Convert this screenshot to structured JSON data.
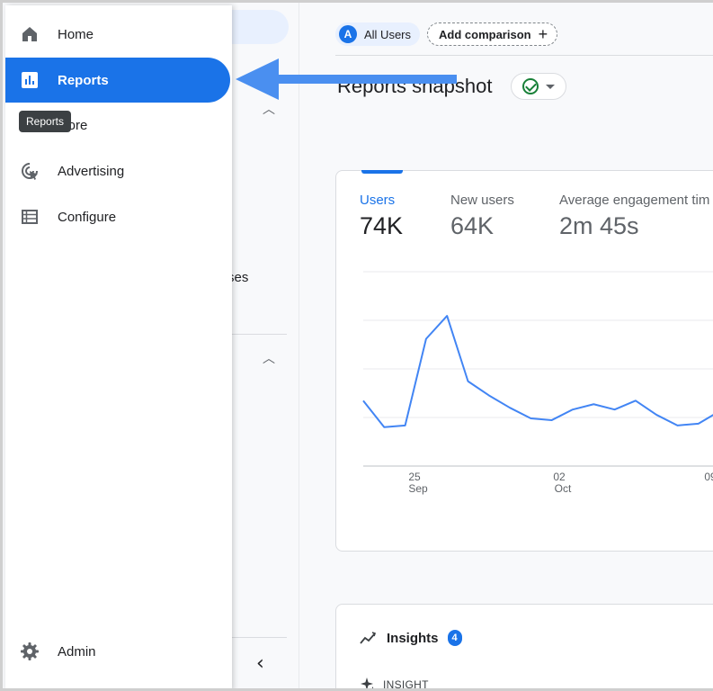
{
  "nav": {
    "items": [
      {
        "label": "Home",
        "icon": "home-icon"
      },
      {
        "label": "Reports",
        "icon": "reports-icon",
        "active": true
      },
      {
        "label": "plore",
        "icon": "explore-icon"
      },
      {
        "label": "Advertising",
        "icon": "advertising-icon"
      },
      {
        "label": "Configure",
        "icon": "configure-icon"
      }
    ],
    "admin_label": "Admin",
    "tooltip": "Reports"
  },
  "subpanel": {
    "partial_text": "ses"
  },
  "comparison": {
    "segment_avatar": "A",
    "segment_label": "All Users",
    "add_label": "Add comparison",
    "add_icon": "+"
  },
  "snapshot": {
    "title": "Reports snapshot"
  },
  "metrics": [
    {
      "label": "Users",
      "value": "74K",
      "active": true
    },
    {
      "label": "New users",
      "value": "64K"
    },
    {
      "label": "Average engagement tim",
      "value": "2m 45s"
    }
  ],
  "chart_data": {
    "type": "line",
    "series": [
      {
        "values": [
          37,
          22,
          23,
          72,
          85,
          48,
          40,
          33,
          27,
          26,
          32,
          35,
          32,
          37,
          29,
          23,
          24,
          31
        ]
      }
    ],
    "x_tick_labels": [
      {
        "day": "25",
        "month": "Sep"
      },
      {
        "day": "02",
        "month": "Oct"
      },
      {
        "day": "09",
        "month": ""
      }
    ],
    "ylim": [
      0,
      110
    ],
    "grid": true,
    "color": "#4285f4"
  },
  "insights": {
    "title": "Insights",
    "count": "4",
    "insight_label": "INSIGHT"
  },
  "colors": {
    "accent": "#1a73e8",
    "line": "#4285f4",
    "arrow": "#4a8ff0"
  }
}
